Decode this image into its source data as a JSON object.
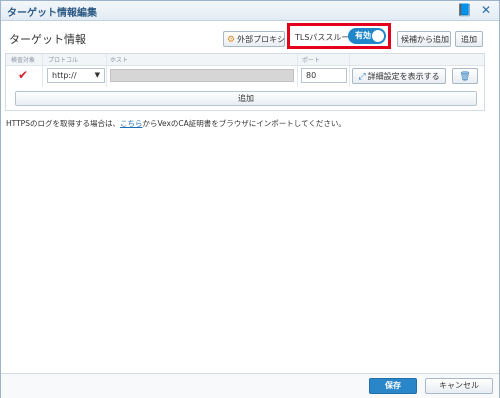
{
  "window": {
    "title": "ターゲット情報編集",
    "book_icon": "book-icon",
    "close_icon": "close-icon"
  },
  "section": {
    "title": "ターゲット情報"
  },
  "toolbar": {
    "proxy_label": "外部プロキシ",
    "tls_label": "TLSパススルー",
    "tls_toggle_label": "有効",
    "add_from_candidates_label": "候補から追加",
    "add_label": "追加"
  },
  "table": {
    "columns": [
      "検査対象",
      "プロトコル",
      "ホスト",
      "ポート"
    ],
    "row": {
      "checked": "✔",
      "protocol": "http://",
      "host": "",
      "port": "80",
      "details_label": "詳細設定を表示する"
    },
    "add_row_label": "追加"
  },
  "info": {
    "text_before": "HTTPSのログを取得する場合は、",
    "link_text": "こちら",
    "text_after": "からVexのCA証明書をブラウザにインポートしてください。"
  },
  "footer": {
    "save_label": "保存",
    "cancel_label": "キャンセル"
  },
  "colors": {
    "accent": "#2a86c8",
    "highlight": "#e4001c",
    "check": "#d9202c"
  }
}
